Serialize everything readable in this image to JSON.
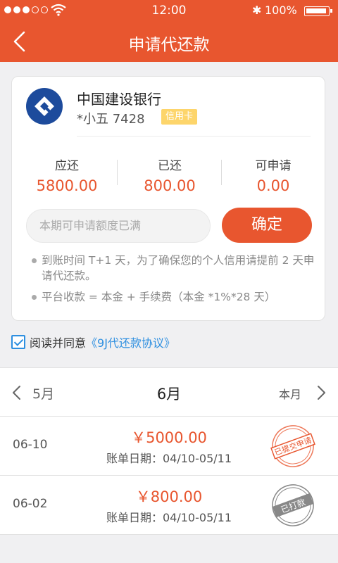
{
  "status_bar": {
    "time": "12:00",
    "battery": "100%"
  },
  "nav": {
    "title": "申请代还款"
  },
  "card": {
    "bank_name": "中国建设银行",
    "account": "*小五 7428",
    "card_type": "信用卡",
    "stats": [
      {
        "label": "应还",
        "value": "5800.00"
      },
      {
        "label": "已还",
        "value": "800.00"
      },
      {
        "label": "可申请",
        "value": "0.00"
      }
    ],
    "input_placeholder": "本期可申请额度已满",
    "confirm_label": "确定",
    "notes": [
      "到账时间 T+1 天，为了确保您的个人信用请提前 2 天申请代还款。",
      "平台收款 = 本金 + 手续费（本金 *1%*28 天）"
    ]
  },
  "agreement": {
    "checked": true,
    "text": "阅读并同意",
    "link": "《9J代还款协议》"
  },
  "month_nav": {
    "prev": "5月",
    "current": "6月",
    "this_month": "本月"
  },
  "bills": [
    {
      "date": "06-10",
      "amount": "￥5000.00",
      "period": "账单日期：04/10-05/11",
      "stamp": "已提交申请",
      "stamp_color": "#e8562f"
    },
    {
      "date": "06-02",
      "amount": "￥800.00",
      "period": "账单日期：04/10-05/11",
      "stamp": "已打款",
      "stamp_color": "#888888"
    }
  ],
  "colors": {
    "accent": "#e8562f",
    "link": "#2e8fe0",
    "bank_blue": "#1d4b9c",
    "badge": "#fdd56b"
  }
}
